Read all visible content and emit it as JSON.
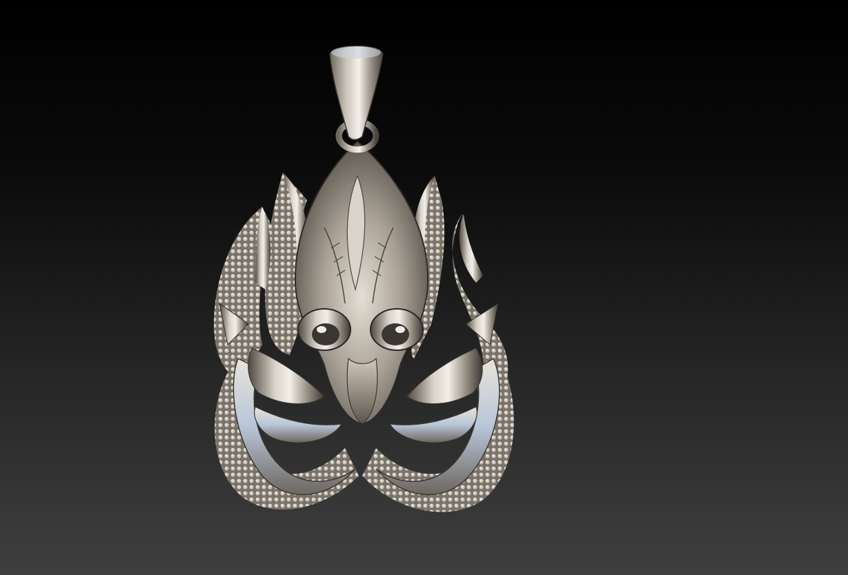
{
  "viewport": {
    "background_top": "#000000",
    "background_bottom": "#3f3f3f"
  },
  "model": {
    "subject": "octopus-pendant",
    "metal_light": "#e9e4dc",
    "metal_mid": "#a9a196",
    "metal_dark": "#3a3631",
    "highlight_tint": "#b8c9e0"
  }
}
